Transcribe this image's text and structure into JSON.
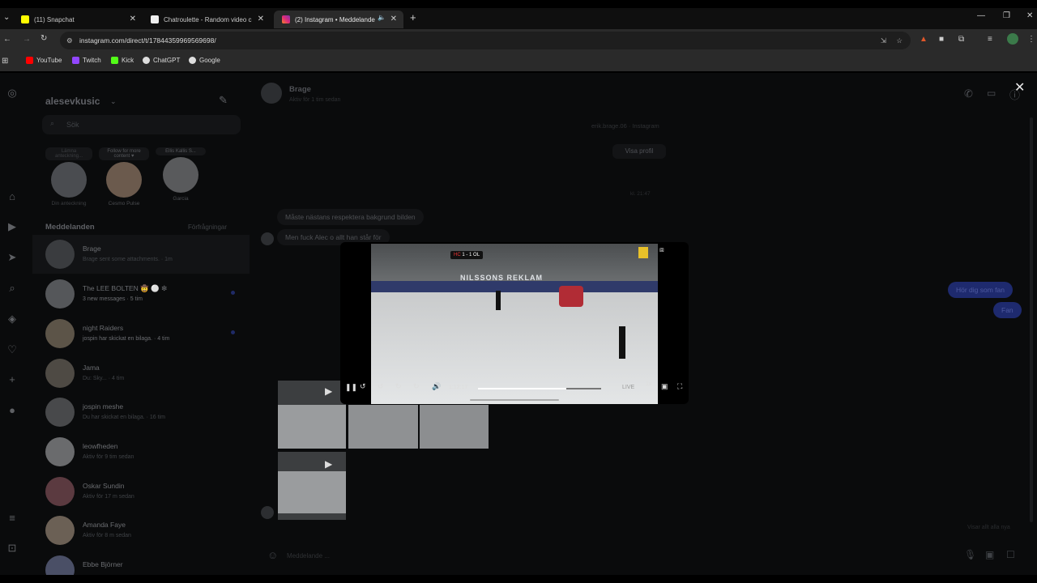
{
  "browser": {
    "tabs": [
      {
        "title": "(11) Snapchat",
        "close": "✕"
      },
      {
        "title": "Chatroulette - Random video c",
        "close": "✕"
      },
      {
        "title": "(2) Instagram • Meddelande",
        "close": "✕"
      }
    ],
    "new_tab": "+",
    "url": "instagram.com/direct/t/17844359969569698/",
    "bookmarks": [
      "YouTube",
      "Twitch",
      "Kick",
      "ChatGPT",
      "Google"
    ]
  },
  "sidebar": {
    "username": "alesevkusic",
    "search_placeholder": "Sök",
    "notes": [
      {
        "note": "Lämna anteckning...",
        "name": "Din anteckning"
      },
      {
        "note": "Follow for more content ♥",
        "name": "Cesmo Pulse"
      },
      {
        "note": "Ellis Kallis S...",
        "name": "Garcia"
      }
    ],
    "messages_heading": "Meddelanden",
    "requests_label": "Förfrågningar",
    "conversations": [
      {
        "name": "Brage",
        "sub": "Brage sent some attachments. · 1m",
        "unread": false
      },
      {
        "name": "The LEE BOLTEN 🤠 ⚪ ❇",
        "sub": "3 new messages · 5 tim",
        "unread": true
      },
      {
        "name": "night Raiders",
        "sub": "jospin har skickat en bilaga. · 4 tim",
        "unread": true
      },
      {
        "name": "Jama",
        "sub": "Du: Sky... · 4 tim",
        "unread": false
      },
      {
        "name": "jospin meshe",
        "sub": "Du har skickat en bilaga. · 16 tim",
        "unread": false
      },
      {
        "name": "leowfheden",
        "sub": "Aktiv för 9 tim sedan",
        "unread": false
      },
      {
        "name": "Oskar Sundin",
        "sub": "Aktiv för 17 m sedan",
        "unread": false
      },
      {
        "name": "Amanda Faye",
        "sub": "Aktiv för 8 m sedan",
        "unread": false
      },
      {
        "name": "Ebbe Björner",
        "sub": "",
        "unread": false
      }
    ]
  },
  "conversation": {
    "name": "Brage",
    "status": "Aktiv för 1 tim sedan",
    "profile_line": "erik.brage.06 · Instagram",
    "view_profile": "Visa profil",
    "timestamp": "kl. 21:47",
    "messages_in": [
      "Måste nästans respektera bakgrund bilden",
      "Men fuck Alec o allt han står för"
    ],
    "messages_out": [
      "Hör dig som fan",
      "Fan"
    ],
    "seen_label": "Visar allt alla nya",
    "input_placeholder": "Meddelande ..."
  },
  "player": {
    "time": "1:12:17",
    "live_label": "LIVE",
    "speed_label": "1x",
    "progress": 0.72,
    "banner_text": "NILSSONS REKLAM",
    "score_left": "1",
    "score_right": "1",
    "team_left": "HC",
    "team_right": "OL"
  },
  "close_label": "✕"
}
